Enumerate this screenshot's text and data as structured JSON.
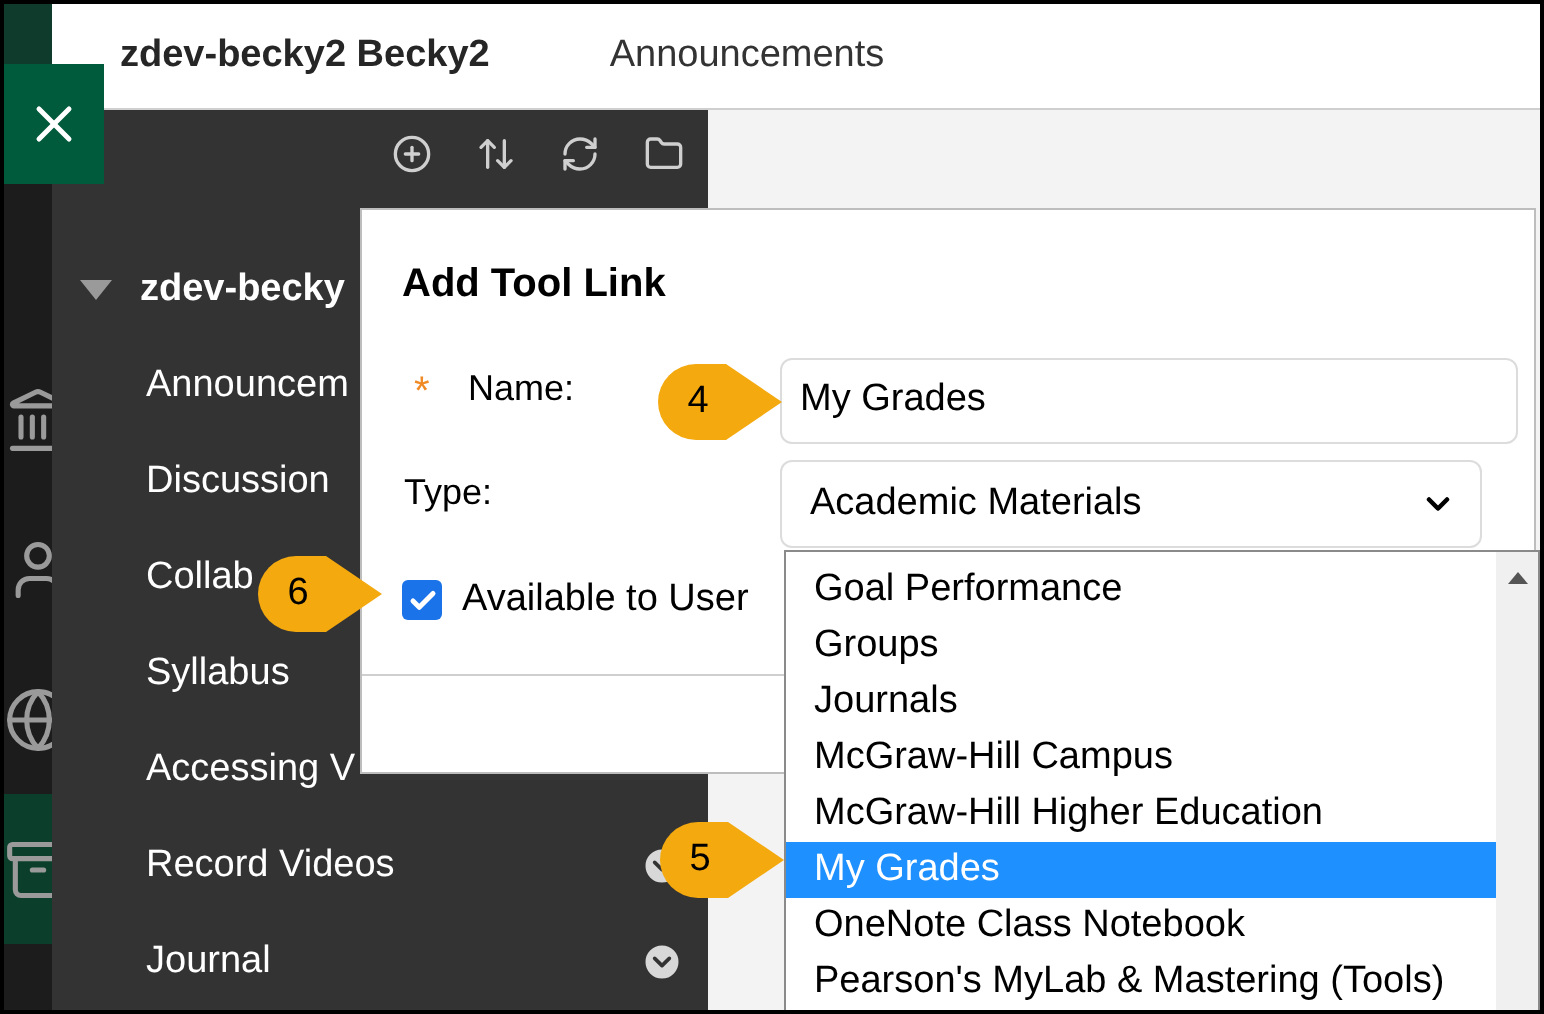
{
  "header": {
    "course_title": "zdev-becky2 Becky2",
    "page_title": "Announcements"
  },
  "nav_strip": [
    {
      "kind": "institution",
      "selected": false
    },
    {
      "kind": "person",
      "selected": false
    },
    {
      "kind": "globe",
      "selected": false
    },
    {
      "kind": "course",
      "selected": true
    }
  ],
  "sidebar": {
    "heading": "zdev-becky",
    "expanded": true,
    "items": [
      {
        "label": "Announcem"
      },
      {
        "label": "Discussion"
      },
      {
        "label": "Collab"
      },
      {
        "label": "Syllabus"
      },
      {
        "label": "Accessing V"
      },
      {
        "label": "Record Videos",
        "menu": true
      },
      {
        "label": "Journal",
        "menu": true
      }
    ]
  },
  "dialog": {
    "title": "Add Tool Link",
    "name_field": {
      "required_mark": "*",
      "label": "Name:",
      "value": "My Grades"
    },
    "type_field": {
      "label": "Type:",
      "value": "Academic Materials"
    },
    "availability": {
      "label": "Available to User",
      "checked": true
    }
  },
  "dropdown": {
    "options": [
      {
        "label": "Goal Performance",
        "selected": false
      },
      {
        "label": "Groups",
        "selected": false
      },
      {
        "label": "Journals",
        "selected": false
      },
      {
        "label": "McGraw-Hill Campus",
        "selected": false
      },
      {
        "label": "McGraw-Hill Higher Education",
        "selected": false
      },
      {
        "label": "My Grades",
        "selected": true
      },
      {
        "label": "OneNote Class Notebook",
        "selected": false
      },
      {
        "label": "Pearson's MyLab & Mastering (Tools)",
        "selected": false
      }
    ]
  },
  "callouts": [
    {
      "label": "4"
    },
    {
      "label": "5"
    },
    {
      "label": "6"
    }
  ]
}
